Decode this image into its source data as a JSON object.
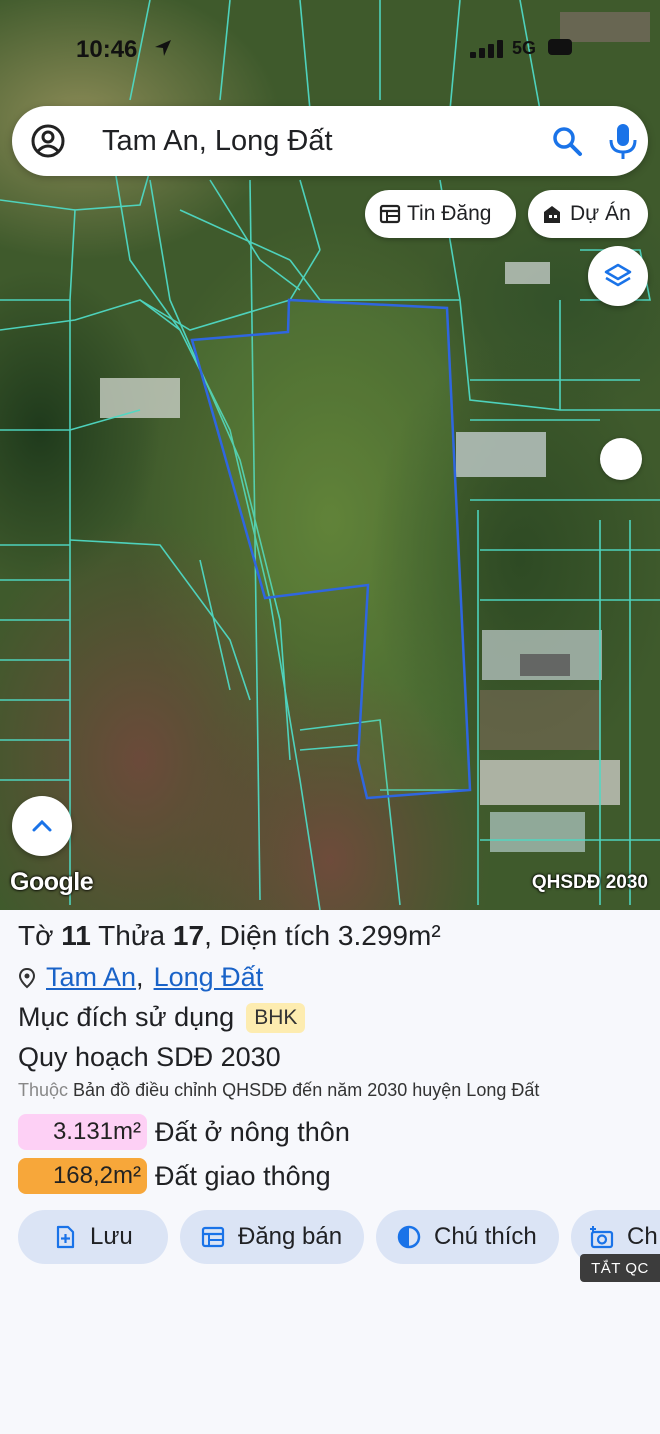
{
  "status_bar": {
    "time": "10:46",
    "network": "5G"
  },
  "search": {
    "query": "Tam An, Long Đất"
  },
  "map": {
    "chips": [
      {
        "label": "Tin Đăng"
      },
      {
        "label": "Dự Án"
      }
    ],
    "logo": "Google",
    "layer_tag": "QHSDĐ 2030",
    "colors": {
      "parcel_lines": "#4fd9c4",
      "selected_parcel": "#2f66e0"
    }
  },
  "parcel": {
    "to_label": "Tờ",
    "to_number": "11",
    "thua_label": "Thửa",
    "thua_number": "17",
    "area_label": ", Diện tích",
    "area_value": "3.299",
    "area_unit": "m²",
    "address": {
      "commune": "Tam An",
      "district": "Long Đất",
      "separator": ","
    },
    "purpose_label": "Mục đích sử dụng",
    "purpose_code": "BHK",
    "plan_label": "Quy hoạch SDĐ 2030",
    "belongs_prefix": "Thuộc",
    "belongs_text": "Bản đồ điều chỉnh QHSDĐ đến năm 2030 huyện Long Đất",
    "zones": [
      {
        "value": "3.131m²",
        "label": "Đất ở nông thôn",
        "color": "#fdd0f5"
      },
      {
        "value": "168,2m²",
        "label": "Đất giao thông",
        "color": "#f7a73a"
      }
    ]
  },
  "actions": [
    {
      "label": "Lưu"
    },
    {
      "label": "Đăng bán"
    },
    {
      "label": "Chú thích"
    },
    {
      "label": "Ch"
    }
  ],
  "ads_tag": "TẮT QC"
}
